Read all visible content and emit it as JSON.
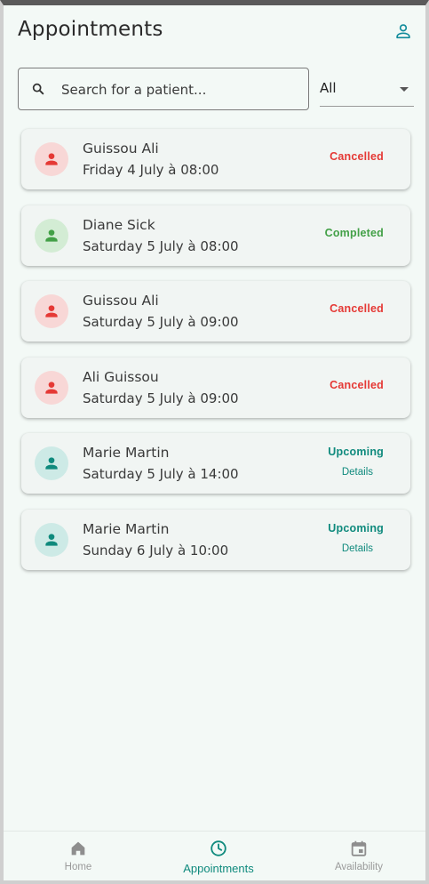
{
  "header": {
    "title": "Appointments"
  },
  "search": {
    "placeholder": "Search for a patient..."
  },
  "filter": {
    "selected": "All"
  },
  "colors": {
    "accent": "#0f8a7d",
    "cancelled": "#e53935",
    "completed": "#43a047",
    "upcoming": "#0f8a7d",
    "cancelled_bg": "#f8d7d6",
    "completed_bg": "#d3ecd4",
    "upcoming_bg": "#cdeae6"
  },
  "appointments": [
    {
      "name": "Guissou Ali",
      "date": "Friday 4 July à 08:00",
      "status": "Cancelled",
      "type": "cancelled"
    },
    {
      "name": "Diane Sick",
      "date": "Saturday 5 July à 08:00",
      "status": "Completed",
      "type": "completed"
    },
    {
      "name": "Guissou Ali",
      "date": "Saturday 5 July à 09:00",
      "status": "Cancelled",
      "type": "cancelled"
    },
    {
      "name": "Ali Guissou",
      "date": "Saturday 5 July à 09:00",
      "status": "Cancelled",
      "type": "cancelled"
    },
    {
      "name": "Marie Martin",
      "date": "Saturday 5 July à 14:00",
      "status": "Upcoming",
      "type": "upcoming",
      "details": "Details"
    },
    {
      "name": "Marie Martin",
      "date": "Sunday 6 July à 10:00",
      "status": "Upcoming",
      "type": "upcoming",
      "details": "Details"
    }
  ],
  "nav": {
    "items": [
      {
        "label": "Home",
        "icon": "home-icon",
        "active": false
      },
      {
        "label": "Appointments",
        "icon": "clock-icon",
        "active": true
      },
      {
        "label": "Availability",
        "icon": "calendar-icon",
        "active": false
      }
    ]
  }
}
